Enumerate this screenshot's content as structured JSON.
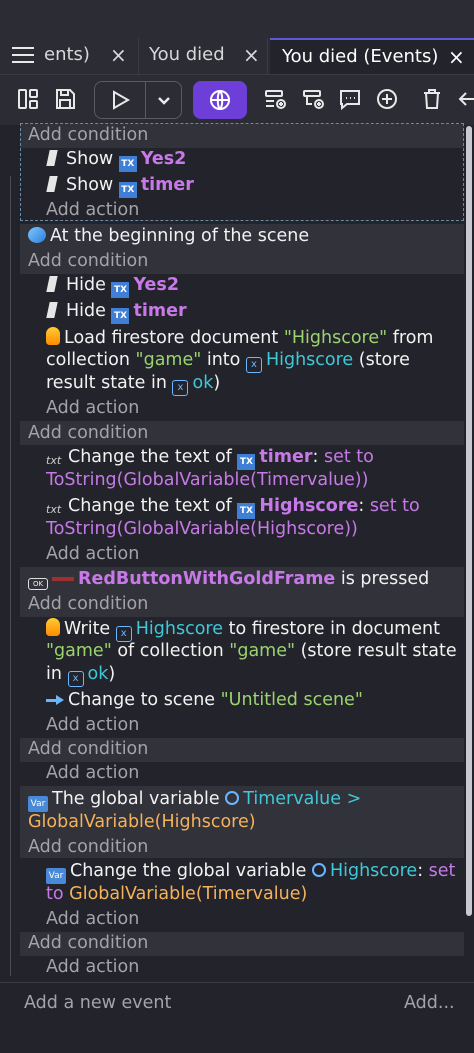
{
  "tabs": [
    {
      "label": "ents)",
      "close": "×"
    },
    {
      "label": "You died",
      "close": "×"
    },
    {
      "label": "You died (Events)",
      "close": "×"
    }
  ],
  "toolbar": {
    "icons": [
      "layout-icon",
      "save-icon",
      "play-icon",
      "chevron-down-icon",
      "globe-icon",
      "add-event-icon",
      "add-subevent-icon",
      "add-comment-icon",
      "add-icon",
      "delete-icon",
      "undo-icon"
    ]
  },
  "events": {
    "add_condition": "Add condition",
    "add_action": "Add action",
    "e1": {
      "a1": {
        "verb": "Show",
        "obj": "Yes2"
      },
      "a2": {
        "verb": "Show",
        "obj": "timer"
      }
    },
    "e2": {
      "cond": "At the beginning of the scene",
      "a1": {
        "verb": "Hide",
        "obj": "Yes2"
      },
      "a2": {
        "verb": "Hide",
        "obj": "timer"
      },
      "a3": {
        "p1": "Load firestore document ",
        "doc": "\"Highscore\"",
        "p2": " from",
        "p3": "collection ",
        "coll": "\"game\"",
        "p4": " into ",
        "var": "Highscore",
        "p5": " (store",
        "p6": "result state in ",
        "var2": "ok",
        "p7": ")"
      }
    },
    "e3": {
      "a1": {
        "p1": "Change the text of ",
        "obj": "timer",
        "p2": ": ",
        "op": "set to",
        "expr": "ToString(GlobalVariable(Timervalue))"
      },
      "a2": {
        "p1": "Change the text of ",
        "obj": "Highscore",
        "p2": ": ",
        "op": "set to",
        "expr": "ToString(GlobalVariable(Highscore))"
      }
    },
    "e4": {
      "cond": {
        "obj": "RedButtonWithGoldFrame",
        "p": " is pressed"
      },
      "a1": {
        "p1": "Write ",
        "var": "Highscore",
        "p2": " to firestore in document",
        "doc": "\"game\"",
        "p3": " of collection ",
        "coll": "\"game\"",
        "p4": " (store result state",
        "p5": "in ",
        "var2": "ok",
        "p6": ")"
      },
      "a2": {
        "p1": "Change to scene ",
        "scene": "\"Untitled scene\""
      }
    },
    "e6": {
      "cond": {
        "p1": "The global variable ",
        "var": "Timervalue",
        "op": " >",
        "expr": "GlobalVariable(Highscore)"
      },
      "a1": {
        "p1": "Change the global variable ",
        "var": "Highscore",
        "p2": ": ",
        "op": "set",
        "op2": "to ",
        "expr": "GlobalVariable(Timervalue)"
      }
    }
  },
  "footer": {
    "add_event": "Add a new event",
    "add_more": "Add..."
  },
  "colors": {
    "accent": "#6d3ed8",
    "object": "#c879e8",
    "string": "#9bd36f",
    "variable": "#40c8d8",
    "expression": "#f4b25a"
  }
}
